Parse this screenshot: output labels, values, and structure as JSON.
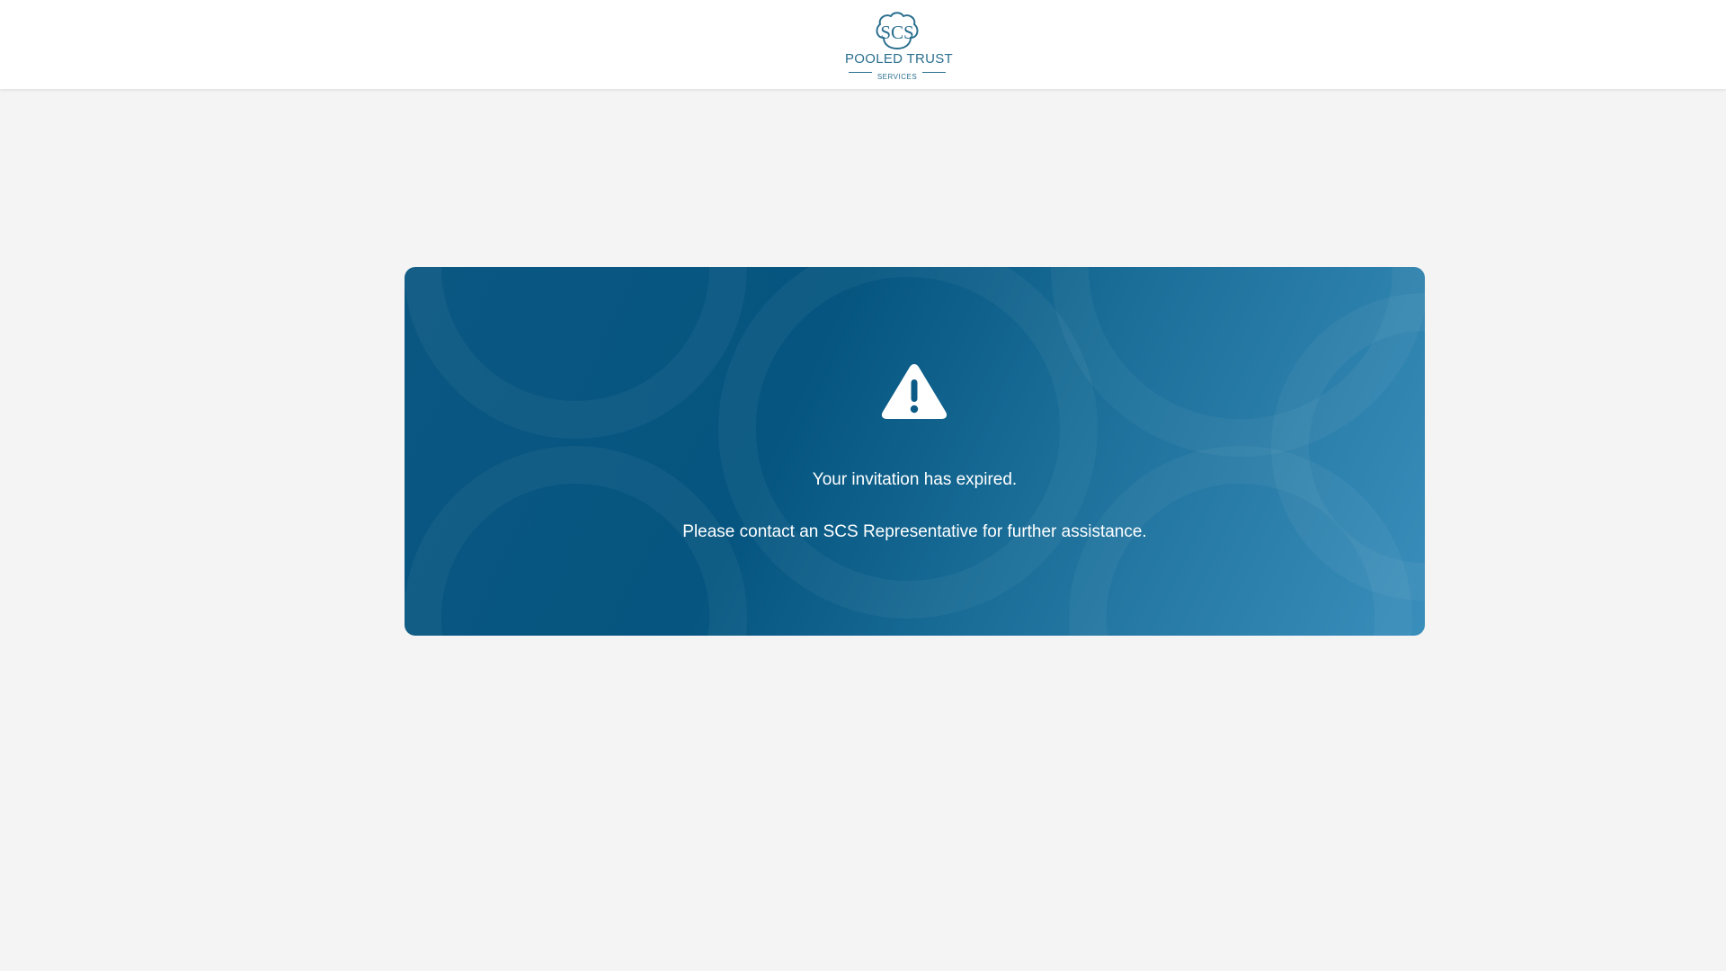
{
  "header": {
    "logo": {
      "monogram": "SCS",
      "line1": "POOLED TRUST",
      "line2": "SERVICES",
      "color": "#2b6f8e"
    }
  },
  "notice": {
    "icon": "warning-triangle-icon",
    "title": "Your invitation has expired.",
    "message": "Please contact an SCS Representative for further assistance."
  },
  "colors": {
    "card_dark": "#055580",
    "card_light": "#3a8ebb",
    "page_background": "#f4f4f4",
    "header_background": "#ffffff"
  }
}
